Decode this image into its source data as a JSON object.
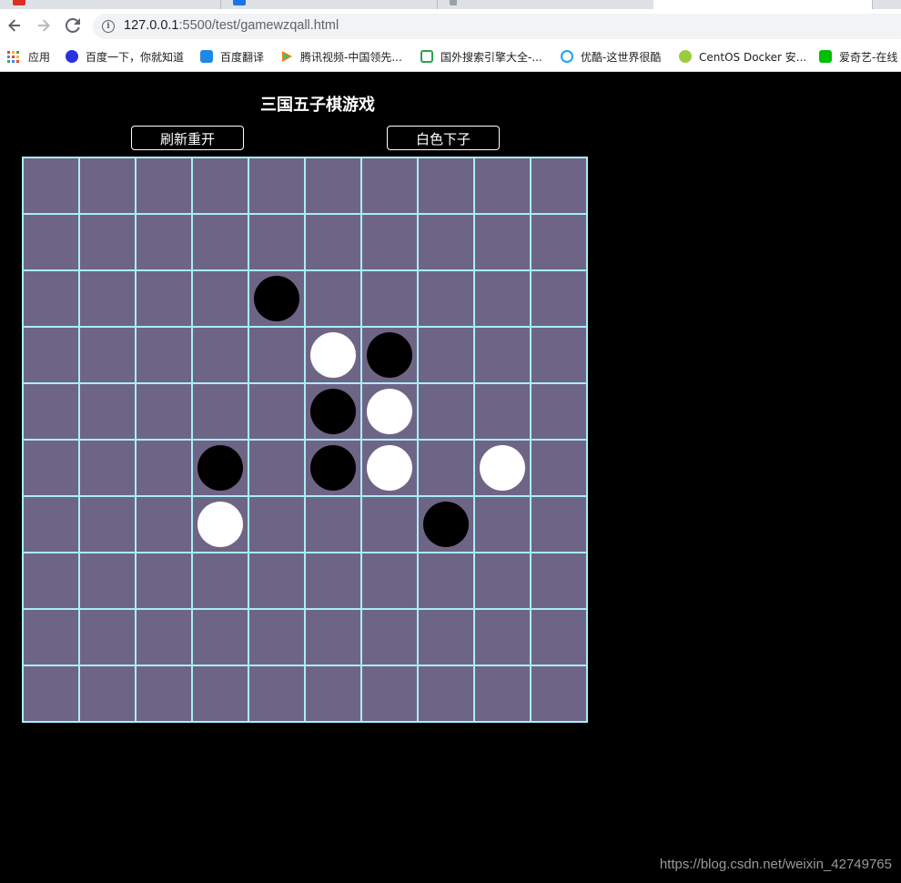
{
  "browser": {
    "url_host": "127.0.0.1",
    "url_rest": ":5500/test/gamewzqall.html",
    "bookmarks": [
      {
        "label": "应用",
        "icon": "apps-icon",
        "color": "#1a73e8"
      },
      {
        "label": "百度一下，你就知道",
        "icon": "baidu-paw-icon",
        "color": "#2932e1"
      },
      {
        "label": "百度翻译",
        "icon": "translate-icon",
        "color": "#1e88e5"
      },
      {
        "label": "腾讯视频-中国领先...",
        "icon": "tencent-video-icon",
        "color": "#ff7c00"
      },
      {
        "label": "国外搜索引擎大全-...",
        "icon": "document-green-icon",
        "color": "#2da14b"
      },
      {
        "label": "优酷-这世界很酷",
        "icon": "youku-icon",
        "color": "#1ea3f0"
      },
      {
        "label": "CentOS Docker 安...",
        "icon": "centos-icon",
        "color": "#9ccc3c"
      },
      {
        "label": "爱奇艺-在线",
        "icon": "iqiyi-icon",
        "color": "#00be06"
      }
    ]
  },
  "game": {
    "title": "三国五子棋游戏",
    "restart_button": "刷新重开",
    "turn_button": "白色下子",
    "grid_size": 10,
    "line_color": "#a8eef5",
    "board_color": "#6e6586",
    "pieces": [
      {
        "row": 2,
        "col": 4,
        "color": "black"
      },
      {
        "row": 3,
        "col": 5,
        "color": "white"
      },
      {
        "row": 3,
        "col": 6,
        "color": "black"
      },
      {
        "row": 4,
        "col": 5,
        "color": "black"
      },
      {
        "row": 4,
        "col": 6,
        "color": "white"
      },
      {
        "row": 5,
        "col": 3,
        "color": "black"
      },
      {
        "row": 5,
        "col": 5,
        "color": "black"
      },
      {
        "row": 5,
        "col": 6,
        "color": "white"
      },
      {
        "row": 5,
        "col": 8,
        "color": "white"
      },
      {
        "row": 6,
        "col": 3,
        "color": "white"
      },
      {
        "row": 6,
        "col": 7,
        "color": "black"
      }
    ]
  },
  "watermark": "https://blog.csdn.net/weixin_42749765"
}
